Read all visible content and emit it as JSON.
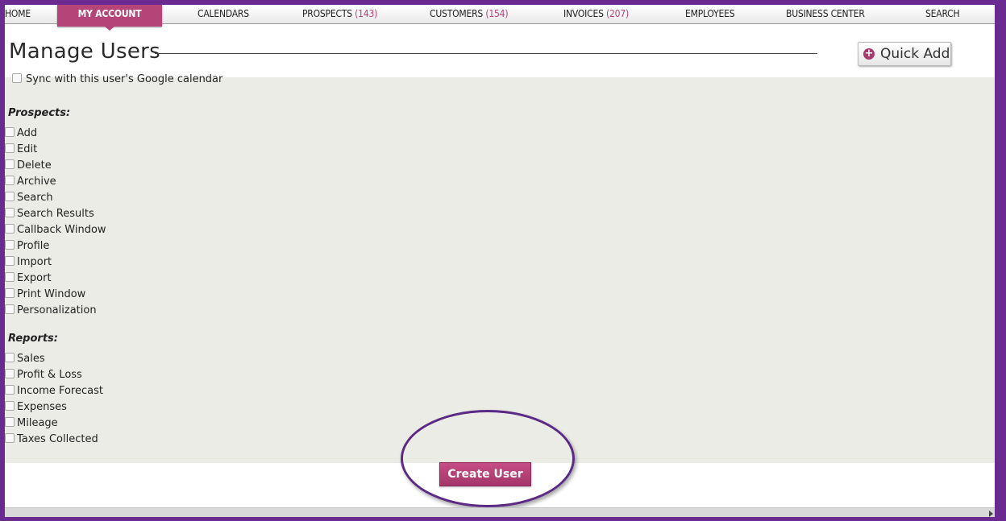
{
  "nav": {
    "home": "HOME",
    "my_account": "MY ACCOUNT",
    "calendars": "CALENDARS",
    "prospects": "PROSPECTS",
    "prospects_count": "(143)",
    "customers": "CUSTOMERS",
    "customers_count": "(154)",
    "invoices": "INVOICES",
    "invoices_count": "(207)",
    "employees": "EMPLOYEES",
    "business_center": "BUSINESS CENTER",
    "search": "SEARCH"
  },
  "header": {
    "title": "Manage Users",
    "quick_add_label": "Quick Add",
    "quick_add_icon": "plus-circle-icon"
  },
  "form": {
    "sync_label": "Sync with this user's Google calendar",
    "prospects_title": "Prospects:",
    "prospects": [
      "Add",
      "Edit",
      "Delete",
      "Archive",
      "Search",
      "Search Results",
      "Callback Window",
      "Profile",
      "Import",
      "Export",
      "Print Window",
      "Personalization"
    ],
    "reports_title": "Reports:",
    "reports": [
      "Sales",
      "Profit & Loss",
      "Income Forecast",
      "Expenses",
      "Mileage",
      "Taxes Collected"
    ],
    "submit_label": "Create User"
  },
  "colors": {
    "frame": "#6b2a8f",
    "accent": "#b54579",
    "form_bg": "#ecece6",
    "highlight_ring": "#5a2a85"
  }
}
